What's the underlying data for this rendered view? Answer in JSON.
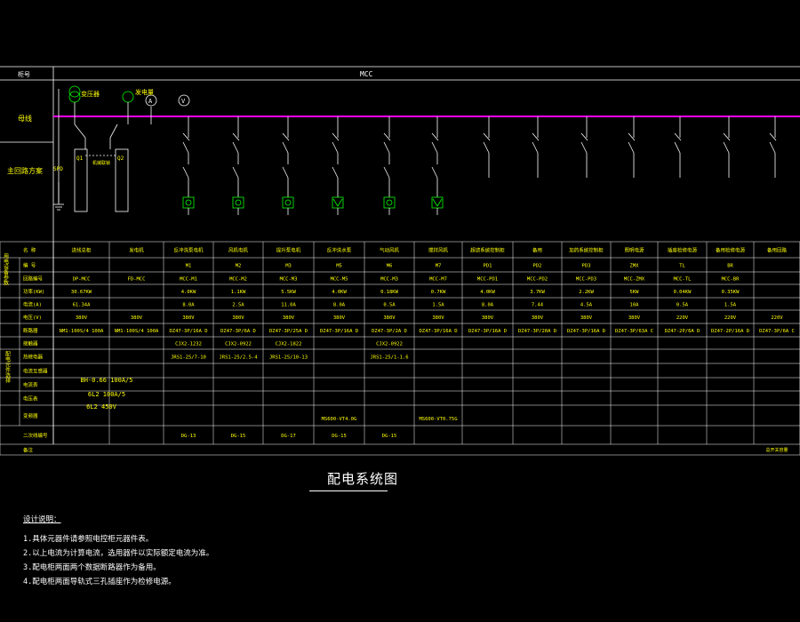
{
  "header": {
    "col_label": "柜号",
    "mcc": "MCC"
  },
  "left_labels": {
    "busbar": "母线",
    "main_circuit": "主回路方案",
    "name": "名  称",
    "number": "编  号",
    "circuit_code": "回路编号",
    "power": "功率(KW)",
    "current": "电流(A)",
    "voltage": "电压(V)",
    "group_parameters": "用电设备参数",
    "group_elements": "配电元件选择",
    "breaker": "断路器",
    "contactor": "接触器",
    "thermal": "热继电器",
    "ct": "电流互感器",
    "ammeter": "电流表",
    "voltmeter": "电压表",
    "inverter": "变频器",
    "cable": "二次线编号",
    "remark": "备注"
  },
  "diagram_labels": {
    "transformer_meter": "变压器",
    "meter2": "发电量",
    "a_meter": "A",
    "v_meter": "V",
    "spd": "SPD",
    "q1": "Q1",
    "q2": "Q2",
    "interlock": "机械联锁"
  },
  "columns": [
    {
      "name": "进线总柜",
      "number": "",
      "code": "DP-MCC",
      "power": "30.67KW",
      "current": "61.34A",
      "voltage": "380V",
      "breaker": "NM1-100S/4 100A",
      "contactor": "",
      "thermal": "",
      "cable": ""
    },
    {
      "name": "发电机",
      "number": "",
      "code": "FD-MCC",
      "power": "",
      "current": "",
      "voltage": "380V",
      "breaker": "NM1-100S/4 100A",
      "contactor": "",
      "thermal": "",
      "cable": ""
    },
    {
      "name": "反冲洗泵电机",
      "number": "M1",
      "code": "MCC-M1",
      "power": "4.0KW",
      "current": "8.0A",
      "voltage": "380V",
      "breaker": "DZ47-3P/16A D",
      "contactor": "CJX2-1232",
      "thermal": "JRS1-25/7-10",
      "cable": "DG-13"
    },
    {
      "name": "风机电机",
      "number": "M2",
      "code": "MCC-M2",
      "power": "1.1KW",
      "current": "2.5A",
      "voltage": "380V",
      "breaker": "DZ47-3P/6A D",
      "contactor": "CJX2-0922",
      "thermal": "JRS1-25/2.5-4",
      "cable": "DG-15"
    },
    {
      "name": "提升泵电机",
      "number": "M3",
      "code": "MCC-M3",
      "power": "5.5KW",
      "current": "11.0A",
      "voltage": "380V",
      "breaker": "DZ47-3P/25A D",
      "contactor": "CJX2-1822",
      "thermal": "JRS1-25/10-13",
      "cable": "DG-17"
    },
    {
      "name": "反冲洗水泵",
      "number": "M5",
      "code": "MCC-M5",
      "power": "4.0KW",
      "current": "8.0A",
      "voltage": "380V",
      "breaker": "DZ47-3P/16A D",
      "contactor": "",
      "thermal": "",
      "cable": "DG-15"
    },
    {
      "name": "气动风机",
      "number": "M6",
      "code": "MCC-M3",
      "power": "0.18KW",
      "current": "0.5A",
      "voltage": "380V",
      "breaker": "DZ47-3P/2A D",
      "contactor": "CJX2-0922",
      "thermal": "JRS1-25/1-1.6",
      "cable": "DG-15"
    },
    {
      "name": "搅拌风机",
      "number": "M7",
      "code": "MCC-M7",
      "power": "0.7KW",
      "current": "1.5A",
      "voltage": "380V",
      "breaker": "DZ47-3P/16A D",
      "contactor": "",
      "thermal": "",
      "cable": ""
    },
    {
      "name": "超滤系统控制柜",
      "number": "PD1",
      "code": "MCC-PD1",
      "power": "4.0KW",
      "current": "8.0A",
      "voltage": "380V",
      "breaker": "DZ47-3P/16A D",
      "contactor": "",
      "thermal": "",
      "cable": ""
    },
    {
      "name": "备用",
      "number": "PD2",
      "code": "MCC-PD2",
      "power": "3.7KW",
      "current": "7.44",
      "voltage": "380V",
      "breaker": "DZ47-3P/20A D",
      "contactor": "",
      "thermal": "",
      "cable": ""
    },
    {
      "name": "加药系统控制柜",
      "number": "PD3",
      "code": "MCC-PD3",
      "power": "2.2KW",
      "current": "4.5A",
      "voltage": "380V",
      "breaker": "DZ47-3P/16A D",
      "contactor": "",
      "thermal": "",
      "cable": ""
    },
    {
      "name": "照明电源",
      "number": "ZMX",
      "code": "MCC-ZMX",
      "power": "5KW",
      "current": "10A",
      "voltage": "380V",
      "breaker": "DZ47-3P/63A C",
      "contactor": "",
      "thermal": "",
      "cable": ""
    },
    {
      "name": "插座检修电源",
      "number": "TL",
      "code": "MCC-TL",
      "power": "0.04KW",
      "current": "0.5A",
      "voltage": "220V",
      "breaker": "DZ47-2P/6A D",
      "contactor": "",
      "thermal": "",
      "cable": ""
    },
    {
      "name": "备用检修电源",
      "number": "BR",
      "code": "MCC-BR",
      "power": "0.35KW",
      "current": "1.5A",
      "voltage": "220V",
      "breaker": "DZ47-2P/16A D",
      "contactor": "",
      "thermal": "",
      "cable": ""
    },
    {
      "name": "备用回路",
      "number": "",
      "code": "",
      "power": "",
      "current": "",
      "voltage": "220V",
      "breaker": "DZ47-3P/6A C",
      "contactor": "",
      "thermal": "",
      "cable": ""
    }
  ],
  "ct_rows": {
    "ct": "BH-0.66 100A/5",
    "ammeter": "6L2  100A/5",
    "voltmeter": "6L2  450V"
  },
  "inverters": {
    "m5": "MS600-VT4.0G",
    "m7": "MS600-VT0.75G"
  },
  "remark_note": "总开关容量",
  "title": "配电系统图",
  "notes": {
    "heading": "设计说明：",
    "items": [
      "1.具体元器件请参照电控柜元器件表。",
      "2.以上电流为计算电流，选用器件以实际额定电流为准。",
      "3.配电柜两面两个数据断路器作为备用。",
      "4.配电柜两面导轨式三孔插座作为检修电源。"
    ]
  },
  "colors": {
    "busbar": "#ff00ff",
    "lines": "#ffffff",
    "symbols": "#00ff00",
    "text": "#ffff00",
    "grid": "#ffffff"
  }
}
